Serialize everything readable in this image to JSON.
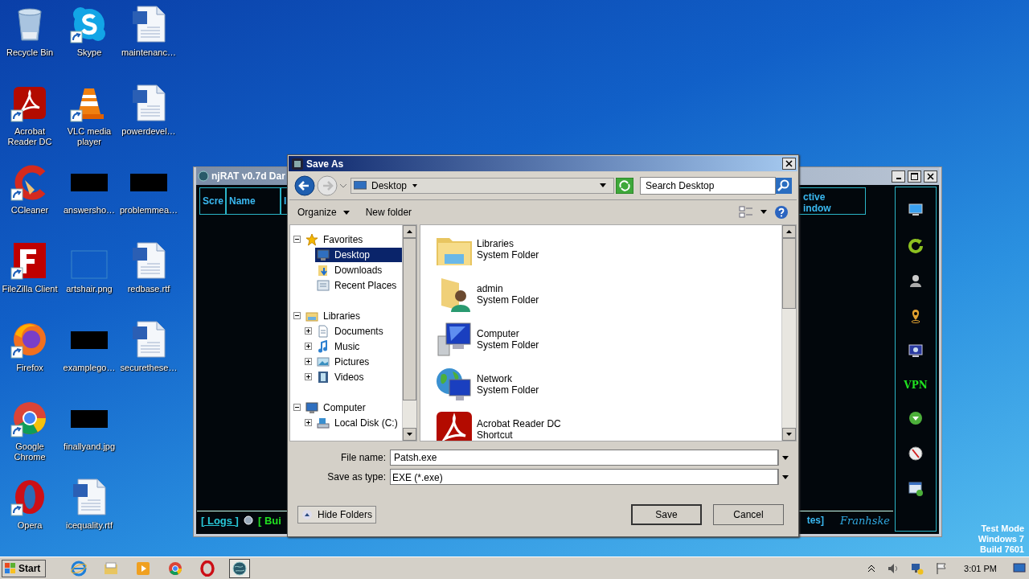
{
  "desktop": {
    "icons": [
      {
        "label": "Recycle Bin",
        "kind": "recycle",
        "shortcut": false
      },
      {
        "label": "Acrobat Reader DC",
        "kind": "acrobat",
        "shortcut": true
      },
      {
        "label": "CCleaner",
        "kind": "ccleaner",
        "shortcut": true
      },
      {
        "label": "FileZilla Client",
        "kind": "filezilla",
        "shortcut": true
      },
      {
        "label": "Firefox",
        "kind": "firefox",
        "shortcut": true
      },
      {
        "label": "Google Chrome",
        "kind": "chrome",
        "shortcut": true
      },
      {
        "label": "Opera",
        "kind": "opera",
        "shortcut": true
      },
      {
        "label": "Skype",
        "kind": "skype",
        "shortcut": true
      },
      {
        "label": "VLC media player",
        "kind": "vlc",
        "shortcut": true
      },
      {
        "label": "answersho…",
        "kind": "redacted",
        "shortcut": false
      },
      {
        "label": "artshair.png",
        "kind": "blank",
        "shortcut": false
      },
      {
        "label": "examplego…",
        "kind": "redacted",
        "shortcut": false
      },
      {
        "label": "finallyand.jpg",
        "kind": "redacted",
        "shortcut": false
      },
      {
        "label": "icequality.rtf",
        "kind": "word",
        "shortcut": false
      },
      {
        "label": "maintenanc…",
        "kind": "word",
        "shortcut": false
      },
      {
        "label": "powerdevel…",
        "kind": "word",
        "shortcut": false
      },
      {
        "label": "problemmea…",
        "kind": "redacted",
        "shortcut": false
      },
      {
        "label": "redbase.rtf",
        "kind": "word",
        "shortcut": false
      },
      {
        "label": "securethese…",
        "kind": "word",
        "shortcut": false
      }
    ]
  },
  "njrat_window": {
    "title": "njRAT v0.7d Dar",
    "columns": [
      "Scre",
      "Name",
      "I"
    ],
    "right_column": [
      "ctive",
      "indow"
    ],
    "tools": [
      {
        "kind": "monitor"
      },
      {
        "kind": "refresh"
      },
      {
        "kind": "user"
      },
      {
        "kind": "pin"
      },
      {
        "kind": "screen"
      },
      {
        "kind": "vpn",
        "label": "VPN"
      },
      {
        "kind": "download"
      },
      {
        "kind": "compass"
      },
      {
        "kind": "add-window"
      }
    ],
    "footer": {
      "logs": "[ Logs ]",
      "builder": "[ Bui",
      "right": "tes]",
      "signature": "Franhske"
    }
  },
  "save_dialog": {
    "title": "Save As",
    "address": "Desktop",
    "search": {
      "placeholder": "Search Desktop"
    },
    "toolbar": [
      {
        "label": "Organize",
        "kind": "menu"
      },
      {
        "label": "New folder",
        "kind": "button"
      }
    ],
    "tree": [
      {
        "label": "Favorites",
        "kind": "star",
        "expanded": true,
        "selected": false,
        "children": [
          {
            "label": "Desktop",
            "kind": "desktop",
            "selected": true
          },
          {
            "label": "Downloads",
            "kind": "downloads",
            "selected": false
          },
          {
            "label": "Recent Places",
            "kind": "recent",
            "selected": false
          }
        ]
      },
      {
        "label": "Libraries",
        "kind": "library",
        "expanded": true,
        "selected": false,
        "children": [
          {
            "label": "Documents",
            "kind": "documents",
            "expanded": false,
            "selected": false
          },
          {
            "label": "Music",
            "kind": "music",
            "expanded": false,
            "selected": false
          },
          {
            "label": "Pictures",
            "kind": "pictures",
            "expanded": false,
            "selected": false
          },
          {
            "label": "Videos",
            "kind": "videos",
            "expanded": false,
            "selected": false
          }
        ]
      },
      {
        "label": "Computer",
        "kind": "computer",
        "expanded": true,
        "selected": false,
        "children": [
          {
            "label": "Local Disk (C:)",
            "kind": "disk",
            "expanded": false,
            "selected": false
          }
        ]
      }
    ],
    "files": [
      {
        "name": "Libraries",
        "type": "System Folder",
        "kind": "libraries"
      },
      {
        "name": "admin",
        "type": "System Folder",
        "kind": "user-folder"
      },
      {
        "name": "Computer",
        "type": "System Folder",
        "kind": "computer"
      },
      {
        "name": "Network",
        "type": "System Folder",
        "kind": "network"
      },
      {
        "name": "Acrobat Reader DC",
        "type": "Shortcut",
        "kind": "acrobat"
      }
    ],
    "file_name_label": "File name:",
    "file_name": "Patsh.exe",
    "type_label": "Save as type:",
    "save_as_type": "EXE (*.exe)",
    "hide_folders": "Hide Folders",
    "buttons": [
      "Save",
      "Cancel"
    ]
  },
  "taskbar": {
    "start": "Start",
    "apps": [
      {
        "kind": "ie",
        "active": false
      },
      {
        "kind": "explorer",
        "active": false
      },
      {
        "kind": "media",
        "active": false
      },
      {
        "kind": "chrome",
        "active": false
      },
      {
        "kind": "opera",
        "active": false
      },
      {
        "kind": "njrat",
        "active": true
      }
    ],
    "clock": "3:01 PM"
  },
  "system_text": [
    "Test Mode",
    "Windows 7",
    "Build 7601"
  ]
}
